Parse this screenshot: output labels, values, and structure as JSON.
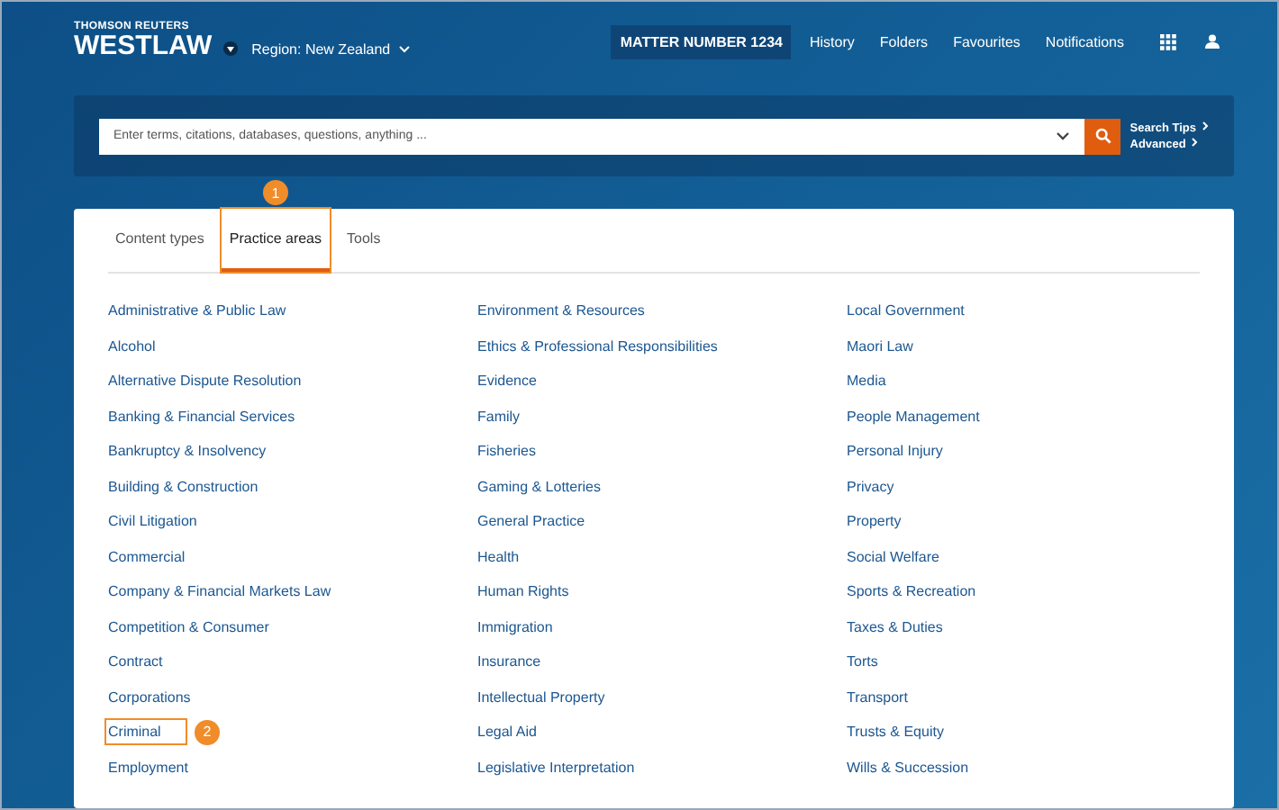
{
  "brand": {
    "company": "THOMSON REUTERS",
    "product": "WESTLAW"
  },
  "region": "Region: New Zealand",
  "nav": {
    "matter": "MATTER NUMBER 1234",
    "links": [
      "History",
      "Folders",
      "Favourites",
      "Notifications"
    ]
  },
  "search": {
    "placeholder": "Enter terms, citations, databases, questions, anything ...",
    "links": [
      "Search Tips",
      "Advanced"
    ]
  },
  "tabs": [
    {
      "label": "Content types",
      "selected": false
    },
    {
      "label": "Practice areas",
      "selected": true,
      "callout": "1"
    },
    {
      "label": "Tools",
      "selected": false
    }
  ],
  "columns": [
    [
      {
        "label": "Administrative & Public Law"
      },
      {
        "label": "Alcohol"
      },
      {
        "label": "Alternative Dispute Resolution"
      },
      {
        "label": "Banking & Financial Services"
      },
      {
        "label": "Bankruptcy & Insolvency"
      },
      {
        "label": "Building & Construction"
      },
      {
        "label": "Civil Litigation"
      },
      {
        "label": "Commercial"
      },
      {
        "label": "Company & Financial Markets Law"
      },
      {
        "label": "Competition & Consumer"
      },
      {
        "label": "Contract"
      },
      {
        "label": "Corporations"
      },
      {
        "label": "Criminal",
        "callout": "2"
      },
      {
        "label": "Employment"
      }
    ],
    [
      {
        "label": "Environment & Resources"
      },
      {
        "label": "Ethics & Professional Responsibilities"
      },
      {
        "label": "Evidence"
      },
      {
        "label": "Family"
      },
      {
        "label": "Fisheries"
      },
      {
        "label": "Gaming & Lotteries"
      },
      {
        "label": "General Practice"
      },
      {
        "label": "Health"
      },
      {
        "label": "Human Rights"
      },
      {
        "label": "Immigration"
      },
      {
        "label": "Insurance"
      },
      {
        "label": "Intellectual Property"
      },
      {
        "label": "Legal Aid"
      },
      {
        "label": "Legislative Interpretation"
      }
    ],
    [
      {
        "label": "Local Government"
      },
      {
        "label": "Maori Law"
      },
      {
        "label": "Media"
      },
      {
        "label": "People Management"
      },
      {
        "label": "Personal Injury"
      },
      {
        "label": "Privacy"
      },
      {
        "label": "Property"
      },
      {
        "label": "Social Welfare"
      },
      {
        "label": "Sports & Recreation"
      },
      {
        "label": "Taxes & Duties"
      },
      {
        "label": "Torts"
      },
      {
        "label": "Transport"
      },
      {
        "label": "Trusts & Equity"
      },
      {
        "label": "Wills & Succession"
      }
    ]
  ]
}
